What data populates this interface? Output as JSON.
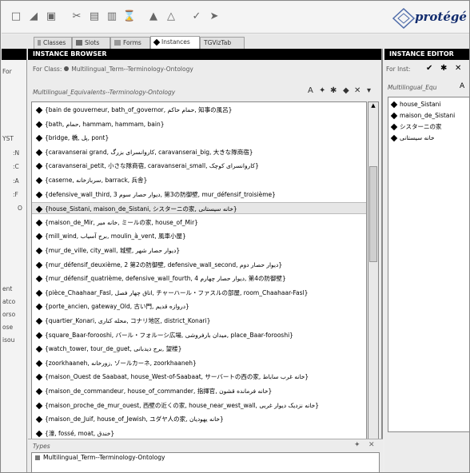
{
  "toolbar": {
    "icons": [
      "new-document-icon",
      "open-folder-icon",
      "save-icon",
      "cut-icon",
      "copy-icon",
      "paste-icon",
      "delete-icon",
      "undo-icon",
      "redo-icon",
      "back-arrow-icon",
      "forward-arrow-icon"
    ]
  },
  "logo": {
    "text": "protégé"
  },
  "tabs": [
    {
      "label": "Classes",
      "selected": false
    },
    {
      "label": "Slots",
      "selected": false
    },
    {
      "label": "Forms",
      "selected": false
    },
    {
      "label": "Instances",
      "selected": true
    },
    {
      "label": "TGVizTab",
      "selected": false
    }
  ],
  "strip": {
    "fragments": [
      "For",
      "YST",
      ":N",
      ":C",
      ":A",
      ":F",
      "O",
      "ent",
      "atco",
      "orso",
      "ose",
      "isou"
    ]
  },
  "browser": {
    "title": "INSTANCE BROWSER",
    "for_class_label": "For Class:",
    "for_class_value": "Multilingual_Term--Terminology-Ontology",
    "sub_header": "Multilingual_Equivalents--Terminology-Ontology",
    "instances": [
      "{bain de gouverneur, bath_of_governor, حمام حاکم, 知事の風呂}",
      "{bath, حمام, hammam, hammam, bain}",
      "{bridge, 橋, پل, pont}",
      "{caravanserai grand, کاروانسرای بزرگ, caravanserai_big, 大きな隊商宿}",
      "{caravanserai_petit, 小さな隊商宿, caravanserai_small, کاروانسرای کوچک}",
      "{caserne, سربازخانه, barrack, 兵舎}",
      "{defensive_wall_third, 3 دیوار حصار سوم, 第3の防御壁, mur_défensif_troisième}",
      "{house_Sistani, maison_de_Sistani, シスターニの家, خانه سیستانی}",
      "{maison_de_Mir, خانه میر, ミールの家, house_of_Mir}",
      "{mill_wind, برج آسیاب, moulin_à_vent, 風車小屋}",
      "{mur_de_ville, city_wall, 城壁, دیوار حصار شهر}",
      "{mur_défensif_deuxième, 2 第2の防御壁, defensive_wall_second, دیوار حصار دوم}",
      "{mur_défensif_quatrième, defensive_wall_fourth, 4 دیوار حصار چهارم, 第4の防御壁}",
      "{pièce_Chaahaar_Fasl, اتاق چهار فصل, チャーハール・ファスルの部屋, room_Chaahaar-Fasl}",
      "{porte_ancien, gateway_Old, 古い門, دروازه قدیم}",
      "{quartier_Konari, محله کناری, コナリ地区, district_Konari}",
      "{square_Baar-forooshi, バール・フォルーシ広場, میدان بارفروشی, place_Baar-forooshi}",
      "{watch_tower, tour_de_guet, برج دیدبانی, 望楼}",
      "{zoorkhaaneh, زورخانه, ゾールカーネ, zoorkhaaneh}",
      "{maison_Ouest de Saabaat, house_West-of-Saabaat, サーバートの西の家, خانه غرب ساباط}",
      "{maison_de_commandeur, house_of_commander, 指揮官, خانه فرمانده قشون}",
      "{maison_proche_de_mur_ouest, 西壁の近くの家, house_near_west_wall, خانه نزدیک دیوار غربی}",
      "{maison_de_Juif, house_of_Jewish, ユダヤ人の家, خانه یهودیان}",
      "{濠, fossé, moat, خندق}"
    ],
    "selected_index": 7
  },
  "types": {
    "label": "Types",
    "value": "Multilingual_Term--Terminology-Ontology"
  },
  "editor": {
    "title": "INSTANCE EDITOR",
    "for_label": "For Inst:",
    "sub_header": "Multilingual_Equ",
    "values": [
      "house_Sistani",
      "maison_de_Sistani",
      "シスターニの家",
      "خانه سیستانی"
    ]
  }
}
